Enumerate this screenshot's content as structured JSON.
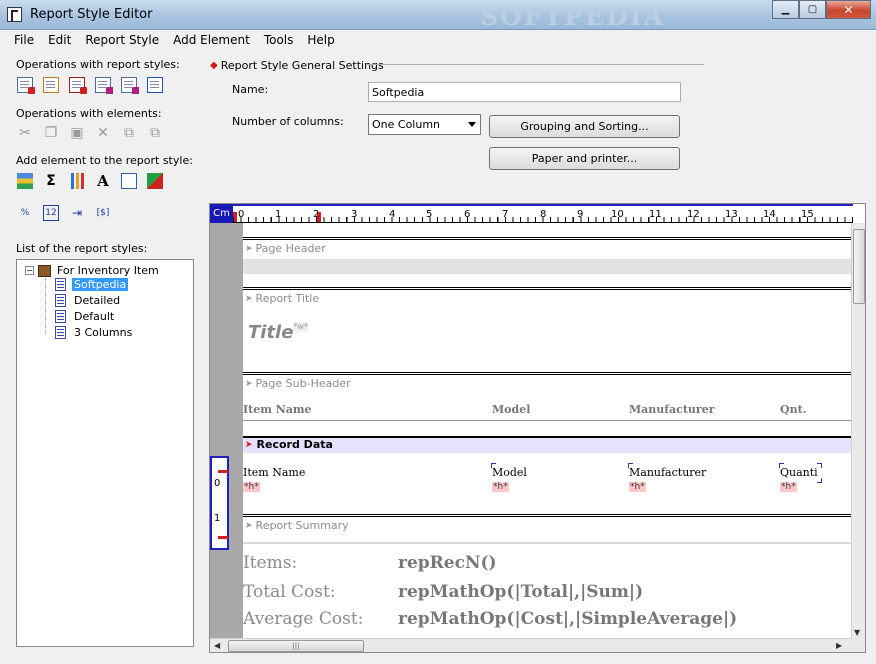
{
  "window": {
    "title": "Report Style Editor",
    "watermark": "SOFTPEDIA"
  },
  "menu": [
    "File",
    "Edit",
    "Report Style",
    "Add Element",
    "Tools",
    "Help"
  ],
  "left": {
    "ops_styles_label": "Operations with report styles:",
    "ops_elements_label": "Operations with elements:",
    "add_element_label": "Add element to the report style:",
    "list_label": "List of the report styles:",
    "extra_icons": {
      "pct": "%",
      "num": "12",
      "bracket": "[$]"
    }
  },
  "tree": {
    "root": "For Inventory Item",
    "items": [
      "Softpedia",
      "Detailed",
      "Default",
      "3 Columns"
    ]
  },
  "settings": {
    "legend": "Report Style General Settings",
    "name_label": "Name:",
    "name_value": "Softpedia",
    "columns_label": "Number of columns:",
    "columns_value": "One Column",
    "grouping_button": "Grouping and Sorting...",
    "paper_button": "Paper and printer..."
  },
  "ruler": {
    "unit": "Cm",
    "numbers": [
      "0",
      "1",
      "2",
      "3",
      "4",
      "5",
      "6",
      "7",
      "8",
      "9",
      "10",
      "11",
      "12",
      "13",
      "14",
      "15"
    ],
    "v_numbers": [
      "0",
      "1"
    ]
  },
  "bands": {
    "page_header": "Page Header",
    "report_title": "Report Title",
    "page_subheader": "Page Sub-Header",
    "record_data": "Record Data",
    "report_summary": "Report Summary"
  },
  "title_field": {
    "text": "Title",
    "sup": "*w*"
  },
  "columns": [
    "Item Name",
    "Model",
    "Manufacturer",
    "Qnt."
  ],
  "record_fields": [
    "Item Name",
    "Model",
    "Manufacturer",
    "Quanti"
  ],
  "record_sub": "*h*",
  "summary": [
    {
      "label": "Items:",
      "value": "repRecN()"
    },
    {
      "label": "Total Cost:",
      "value": "repMathOp(|Total|,|Sum|)"
    },
    {
      "label": "Average Cost:",
      "value": "repMathOp(|Cost|,|SimpleAverage|)"
    }
  ],
  "colors": {
    "accent": "#2020c0",
    "record_band": "#e8e0ff",
    "selected": "#3399ff"
  }
}
